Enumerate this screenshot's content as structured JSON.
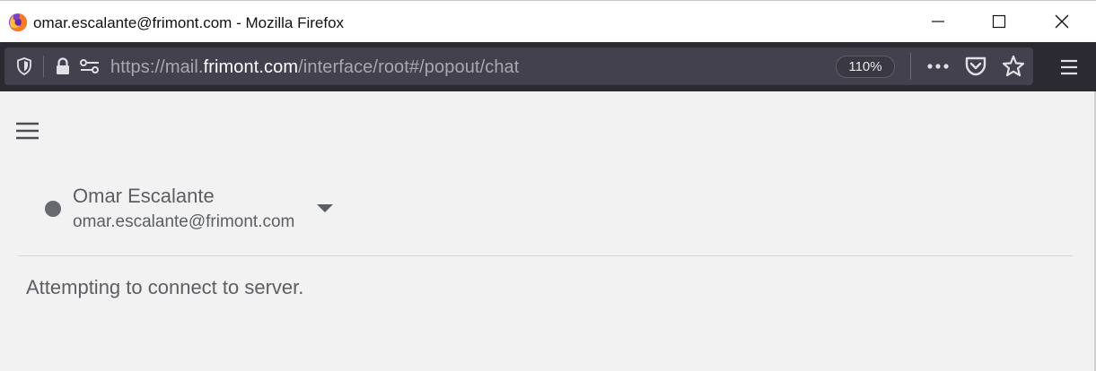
{
  "window": {
    "title": "omar.escalante@frimont.com - Mozilla Firefox",
    "icon": "firefox-icon",
    "controls": [
      "minimize-icon",
      "maximize-icon",
      "close-icon"
    ]
  },
  "toolbar": {
    "url_prefix": "https://mail.",
    "url_host": "frimont.com",
    "url_path": "/interface/root#/popout/chat",
    "zoom": "110%",
    "icons": [
      "shield-icon",
      "lock-icon",
      "permissions-icon",
      "more-icon",
      "pocket-icon",
      "bookmark-star-icon",
      "app-menu-icon"
    ]
  },
  "chat": {
    "menu_icon": "hamburger-icon",
    "user": {
      "name": "Omar Escalante",
      "email": "omar.escalante@frimont.com",
      "status_color": "#666a70"
    },
    "status_message": "Attempting to connect to server."
  }
}
